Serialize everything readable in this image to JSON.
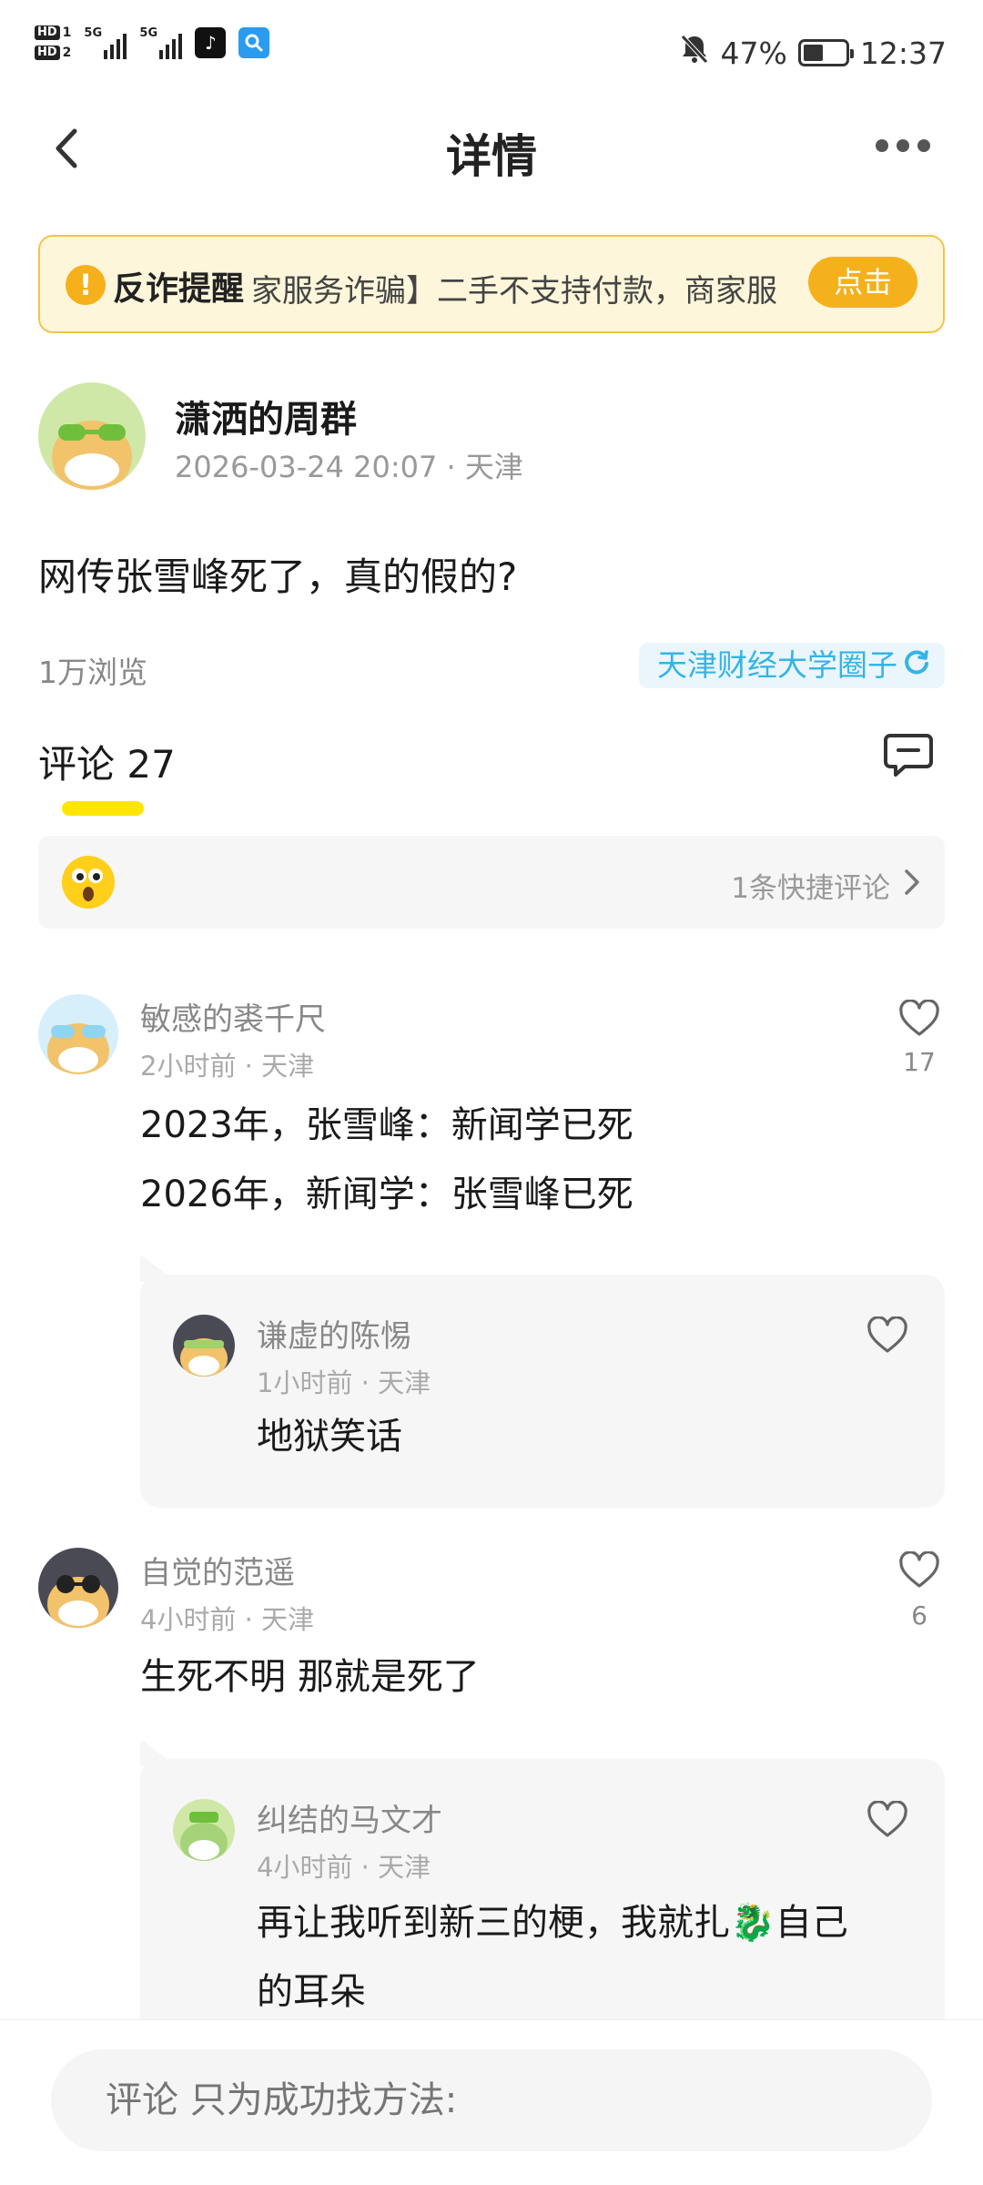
{
  "status_bar": {
    "hd1": "HD",
    "hd1_num": "1",
    "hd2": "HD",
    "hd2_num": "2",
    "sig1_label": "5G",
    "sig2_label": "5G",
    "battery_percent": "47%",
    "battery_level": 0.47,
    "time": "12:37"
  },
  "nav": {
    "title": "详情"
  },
  "fraud_banner": {
    "icon": "!",
    "title": "反诈提醒",
    "text": "家服务诈骗】二手不支持付款，商家服",
    "button": "点击"
  },
  "author": {
    "name": "潇洒的周群",
    "meta": "2026-03-24 20:07 · 天津"
  },
  "post": {
    "body": "网传张雪峰死了，真的假的?",
    "views": "1万浏览",
    "circle": "天津财经大学圈子"
  },
  "comments_header": {
    "label": "评论 27"
  },
  "quick_comment": {
    "label": "1条快捷评论"
  },
  "comments": [
    {
      "name": "敏感的裘千尺",
      "meta": "2小时前 · 天津",
      "line1": "2023年，张雪峰：新闻学已死",
      "line2": "2026年，新闻学：张雪峰已死",
      "likes": "17",
      "reply": {
        "name": "谦虚的陈惕",
        "meta": "1小时前 · 天津",
        "text": "地狱笑话"
      }
    },
    {
      "name": "自觉的范遥",
      "meta": "4小时前 · 天津",
      "line1": "生死不明 那就是死了",
      "likes": "6",
      "reply": {
        "name": "纠结的马文才",
        "meta": "4小时前 · 天津",
        "line1": "再让我听到新三的梗，我就扎🐉自己",
        "line2": "的耳朵"
      }
    }
  ],
  "bottom_bar": {
    "placeholder": "评论 只为成功找方法:"
  },
  "icons": {
    "back": "back-chevron-icon",
    "more": "more-dots-icon",
    "comment": "comment-bubble-icon",
    "like": "heart-icon",
    "chevron": "chevron-right-icon",
    "refresh": "refresh-icon"
  },
  "colors": {
    "accent_yellow": "#f5b11b",
    "banner_bg": "#fdf6da",
    "circle_blue": "#35b4e4",
    "underline_yellow": "#ffe600"
  }
}
